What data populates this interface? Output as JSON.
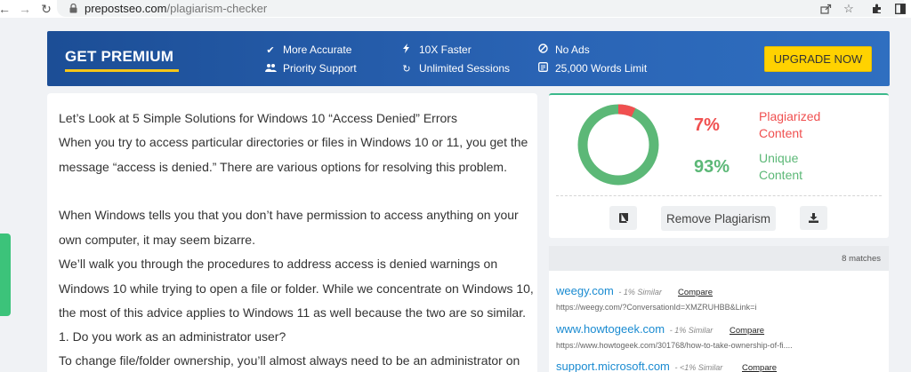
{
  "browser": {
    "back_icon": "arrow-left-icon",
    "forward_icon": "arrow-right-icon",
    "reload_icon": "reload-icon",
    "url_host": "prepostseo.com",
    "url_path": "/plagiarism-checker"
  },
  "banner": {
    "title": "GET PREMIUM",
    "features": [
      {
        "icon": "check-icon",
        "label": "More Accurate"
      },
      {
        "icon": "users-icon",
        "label": "Priority Support"
      },
      {
        "icon": "bolt-icon",
        "label": "10X Faster"
      },
      {
        "icon": "sync-icon",
        "label": "Unlimited Sessions"
      },
      {
        "icon": "ban-icon",
        "label": "No Ads"
      },
      {
        "icon": "document-icon",
        "label": "25,000 Words Limit"
      }
    ],
    "upgrade_label": "UPGRADE NOW",
    "accent_color": "#f5c518"
  },
  "article": {
    "lines": [
      "Let’s Look at 5 Simple Solutions for Windows 10 “Access Denied” Errors",
      "When you try to access particular directories or files in Windows 10 or 11, you get the",
      "message “access is denied.” There are various options for resolving this problem.",
      "When Windows tells you that you don’t have permission to access anything on your",
      "own computer, it may seem bizarre.",
      "We’ll walk you through the procedures to address access is denied warnings on",
      "Windows 10 while trying to open a file or folder. While we concentrate on Windows 10,",
      "the most of this advice applies to Windows 11 as well because the two are so similar.",
      "1. Do you work as an administrator user?",
      "To change file/folder ownership, you’ll almost always need to be an administrator on"
    ]
  },
  "result": {
    "plagiarized_pct": "7%",
    "plagiarized_label_1": "Plagiarized",
    "plagiarized_label_2": "Content",
    "unique_pct": "93%",
    "unique_label_1": "Unique",
    "unique_label_2": "Content",
    "plagiarized_fraction": 0.07,
    "plagiarized_color": "#f05050",
    "unique_color": "#5cb877",
    "remove_label": "Remove Plagiarism"
  },
  "matches": {
    "count_label": "8 matches",
    "items": [
      {
        "site": "weegy.com",
        "similar": "- 1% Similar",
        "compare": "Compare",
        "url": "https://weegy.com/?ConversationId=XMZRUHBB&Link=i"
      },
      {
        "site": "www.howtogeek.com",
        "similar": "- 1% Similar",
        "compare": "Compare",
        "url": "https://www.howtogeek.com/301768/how-to-take-ownership-of-fi...."
      },
      {
        "site": "support.microsoft.com",
        "similar": "- <1% Similar",
        "compare": "Compare",
        "url": ""
      }
    ]
  }
}
